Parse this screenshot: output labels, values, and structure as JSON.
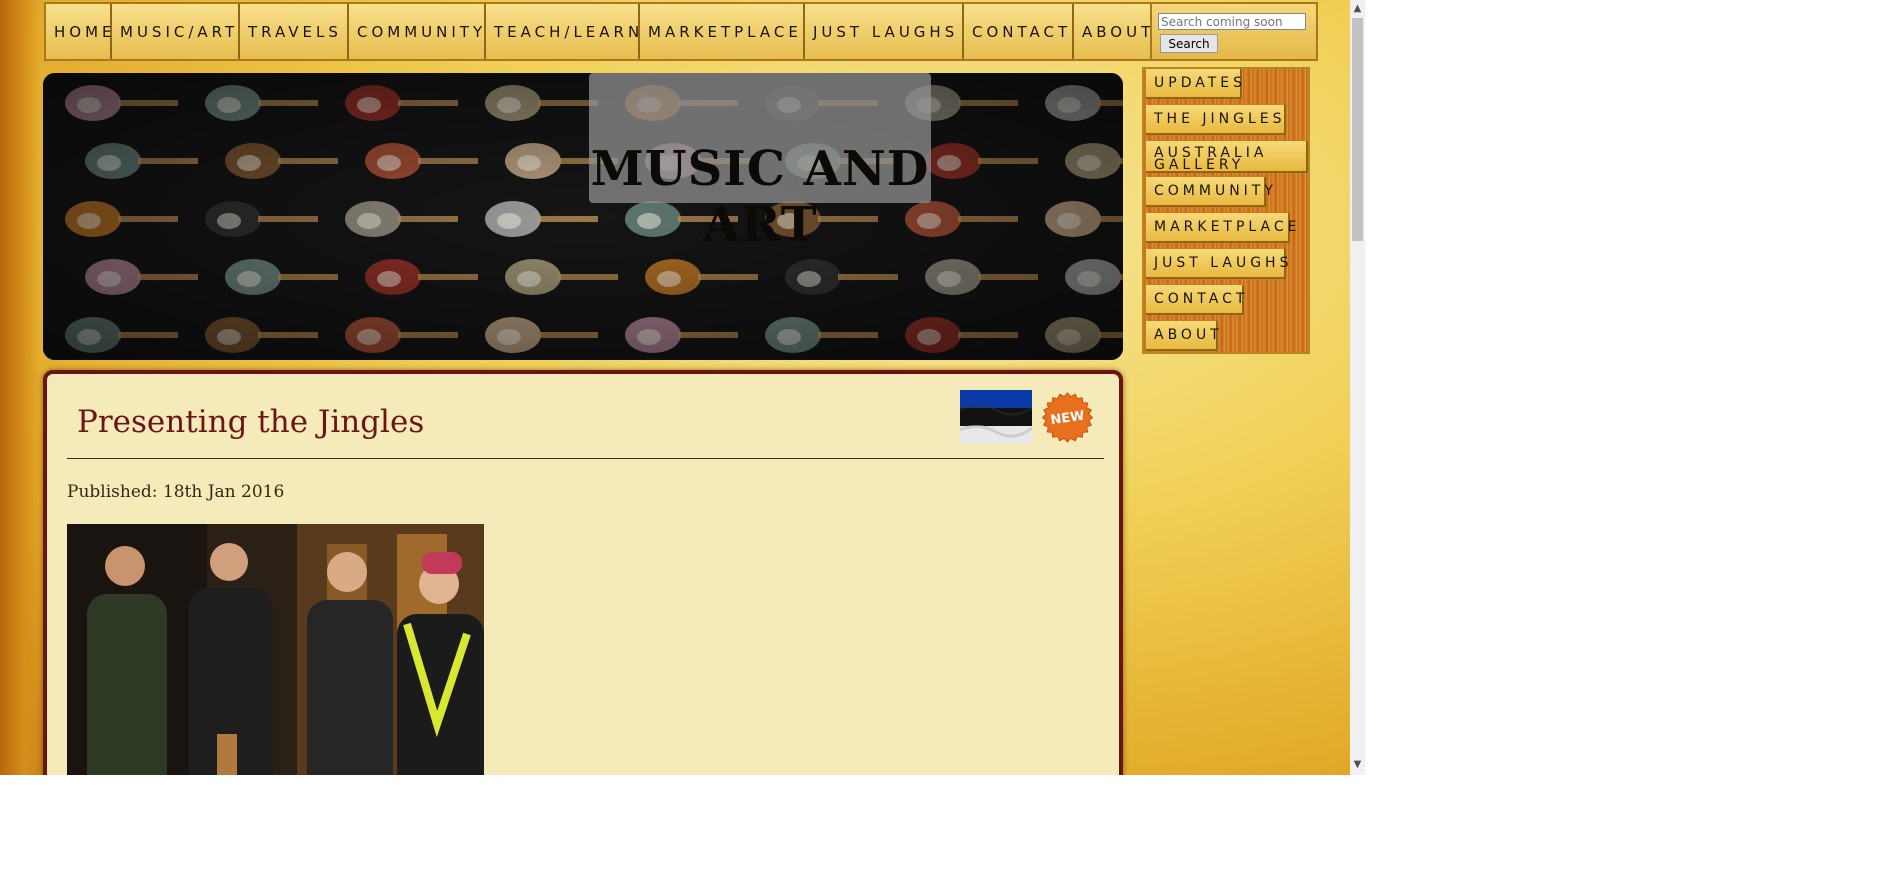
{
  "top_nav": {
    "items": [
      {
        "label": "HOME"
      },
      {
        "label": "MUSIC/ART"
      },
      {
        "label": "TRAVELS"
      },
      {
        "label": "COMMUNITY"
      },
      {
        "label": "TEACH/LEARN"
      },
      {
        "label": "MARKETPLACE"
      },
      {
        "label": "JUST LAUGHS"
      },
      {
        "label": "CONTACT"
      },
      {
        "label": "ABOUT"
      }
    ]
  },
  "search": {
    "placeholder": "Search coming soon",
    "button_label": "Search"
  },
  "banner": {
    "title": "MUSIC AND ART"
  },
  "side_nav": {
    "items": [
      {
        "label": "UPDATES"
      },
      {
        "label": "THE JINGLES"
      },
      {
        "label": "AUSTRALIA GALLERY"
      },
      {
        "label": "COMMUNITY"
      },
      {
        "label": "MARKETPLACE"
      },
      {
        "label": "JUST LAUGHS"
      },
      {
        "label": "CONTACT"
      },
      {
        "label": "ABOUT"
      }
    ]
  },
  "article": {
    "title": "Presenting the Jingles",
    "published": "Published: 18th Jan 2016",
    "badge": "NEW",
    "flag": "estonia-flag-icon"
  },
  "colors": {
    "page_gold": "#f0cf55",
    "content_bg": "#f5eab9",
    "content_border": "#6b1414",
    "title_red": "#6b1616"
  }
}
